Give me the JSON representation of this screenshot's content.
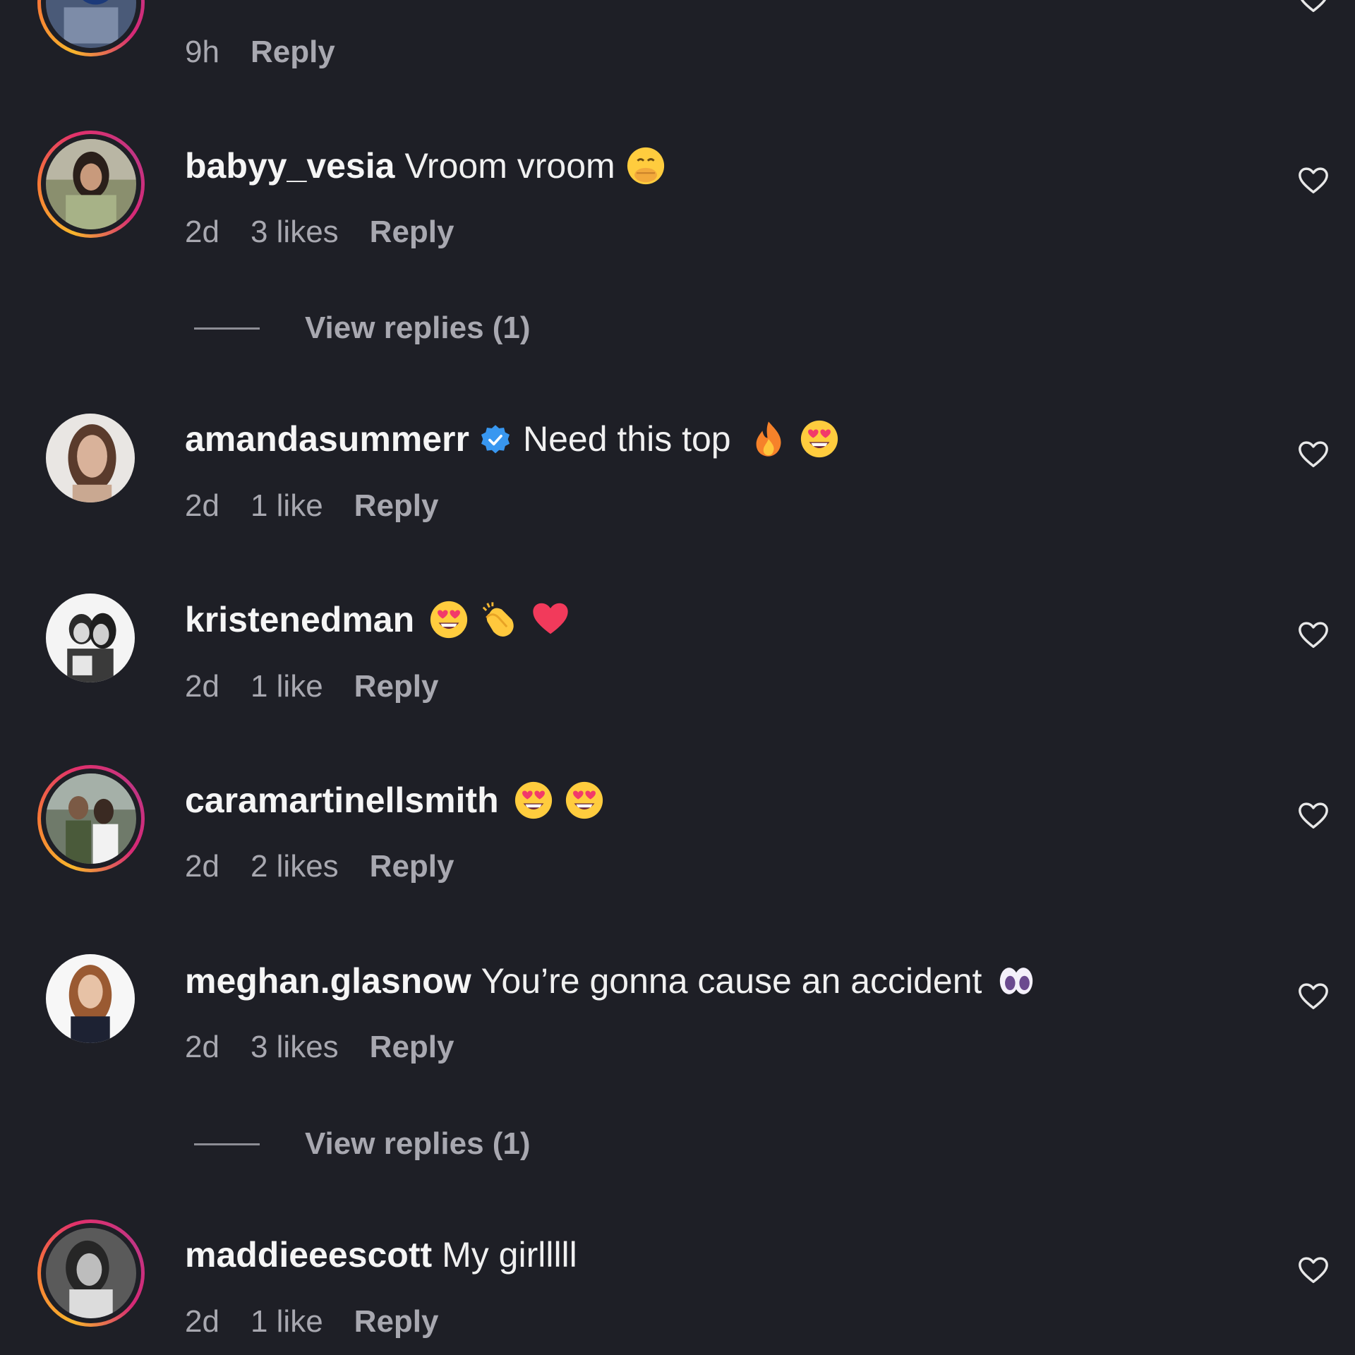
{
  "colors": {
    "background": "#1e1f26",
    "primary_text": "#f2f2f2",
    "secondary_text": "#a8a8b0",
    "verified_badge": "#3897f0",
    "story_ring": [
      "#f7b52c",
      "#e1306c",
      "#c13584"
    ]
  },
  "top_partial": {
    "time": "9h",
    "reply_label": "Reply"
  },
  "comments": [
    {
      "username": "babyy_vesia",
      "verified": false,
      "text": "Vroom vroom",
      "emojis": [
        "face-with-hand-over-mouth-emoji"
      ],
      "time": "2d",
      "likes": "3 likes",
      "reply_label": "Reply",
      "avatar_ring": true,
      "view_replies": "View replies (1)"
    },
    {
      "username": "amandasummerr",
      "verified": true,
      "text": "Need this top",
      "emojis": [
        "fire-emoji",
        "heart-eyes-emoji"
      ],
      "time": "2d",
      "likes": "1 like",
      "reply_label": "Reply",
      "avatar_ring": false
    },
    {
      "username": "kristenedman",
      "verified": false,
      "text": "",
      "emojis": [
        "heart-eyes-emoji",
        "clapping-hands-emoji",
        "red-heart-emoji"
      ],
      "time": "2d",
      "likes": "1 like",
      "reply_label": "Reply",
      "avatar_ring": false
    },
    {
      "username": "caramartinellsmith",
      "verified": false,
      "text": "",
      "emojis": [
        "heart-eyes-emoji",
        "heart-eyes-emoji"
      ],
      "time": "2d",
      "likes": "2 likes",
      "reply_label": "Reply",
      "avatar_ring": true
    },
    {
      "username": "meghan.glasnow",
      "verified": false,
      "text": "You’re gonna cause an accident",
      "emojis": [
        "eyes-emoji"
      ],
      "time": "2d",
      "likes": "3 likes",
      "reply_label": "Reply",
      "avatar_ring": false,
      "view_replies": "View replies (1)"
    },
    {
      "username": "maddieeescott",
      "verified": false,
      "text": "My girlllll",
      "emojis": [],
      "time": "2d",
      "likes": "1 like",
      "reply_label": "Reply",
      "avatar_ring": true
    }
  ]
}
